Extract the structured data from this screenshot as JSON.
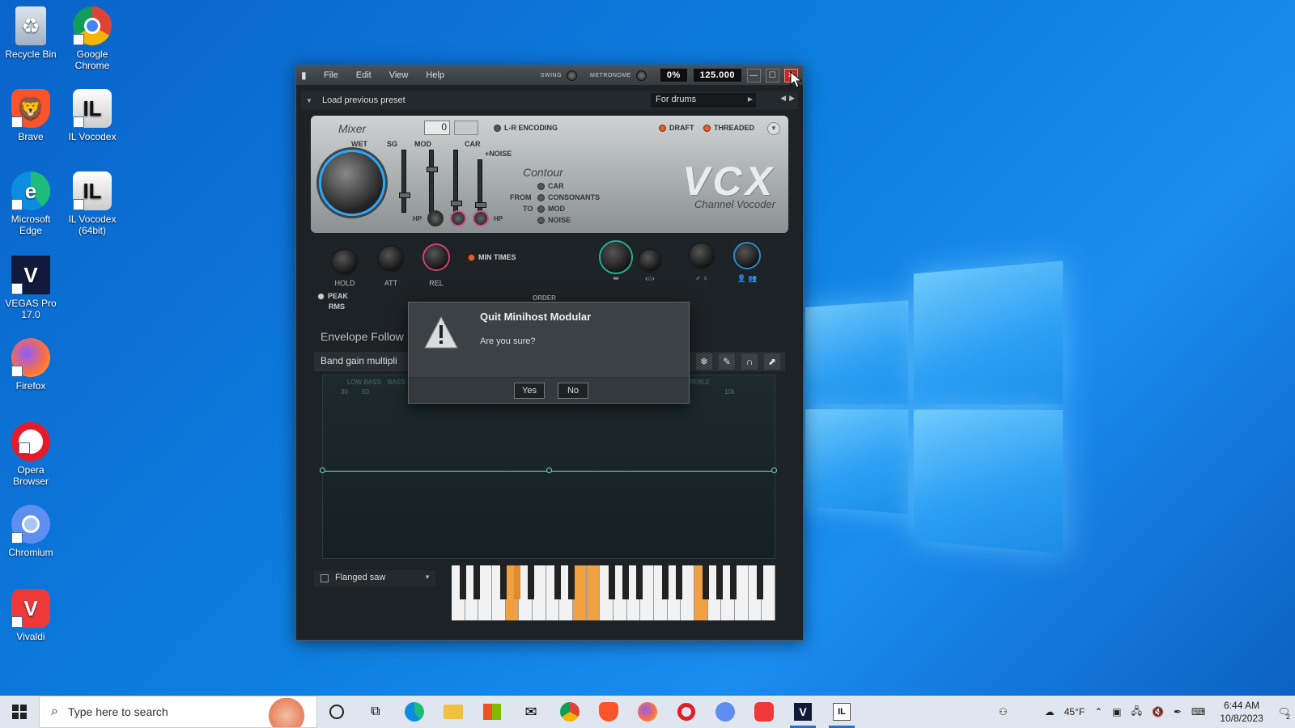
{
  "desktop": {
    "icons": [
      {
        "label": "Recycle Bin"
      },
      {
        "label": "Google Chrome"
      },
      {
        "label": "Brave"
      },
      {
        "label": "IL Vocodex"
      },
      {
        "label": "Microsoft Edge"
      },
      {
        "label": "IL Vocodex (64bit)"
      },
      {
        "label": "VEGAS Pro 17.0"
      },
      {
        "label": "Firefox"
      },
      {
        "label": "Opera Browser"
      },
      {
        "label": "Chromium"
      },
      {
        "label": "Vivaldi"
      }
    ]
  },
  "window": {
    "menu": [
      "File",
      "Edit",
      "View",
      "Help"
    ],
    "swing_label": "SWING",
    "metronome_label": "METRONOME",
    "percent": "0%",
    "tempo": "125.000",
    "preset_label": "Load previous preset",
    "preset_select": "For drums"
  },
  "plugin": {
    "mixer": "Mixer",
    "mixer_value": "0",
    "lr_encoding": "L-R ENCODING",
    "draft": "DRAFT",
    "threaded": "THREADED",
    "wet": "WET",
    "sg": "SG",
    "mod": "MOD",
    "car": "CAR",
    "noise": "+NOISE",
    "hp_left": "HP",
    "hp_right": "HP",
    "contour": "Contour",
    "contour_options": [
      "CAR",
      "CONSONANTS",
      "MOD",
      "NOISE"
    ],
    "from": "FROM",
    "to": "TO",
    "logo": "VCX",
    "subtitle": "Channel Vocoder",
    "hold": "HOLD",
    "att": "ATT",
    "rel": "REL",
    "min_times": "MIN TIMES",
    "peak": "PEAK",
    "rms": "RMS",
    "order": "ORDER",
    "envelope": "Envelope Follow",
    "band_gain": "Band gain multipli",
    "band_labels": [
      "LOW BASS",
      "BASS",
      "REBLE"
    ],
    "band_ticks": [
      "30",
      "50",
      "10k"
    ],
    "instrument": "Flanged saw"
  },
  "dialog": {
    "title": "Quit Minihost Modular",
    "message": "Are you sure?",
    "yes": "Yes",
    "no": "No"
  },
  "taskbar": {
    "search_placeholder": "Type here to search",
    "weather": "45°F",
    "time": "6:44 AM",
    "date": "10/8/2023",
    "notification_count": "2"
  }
}
